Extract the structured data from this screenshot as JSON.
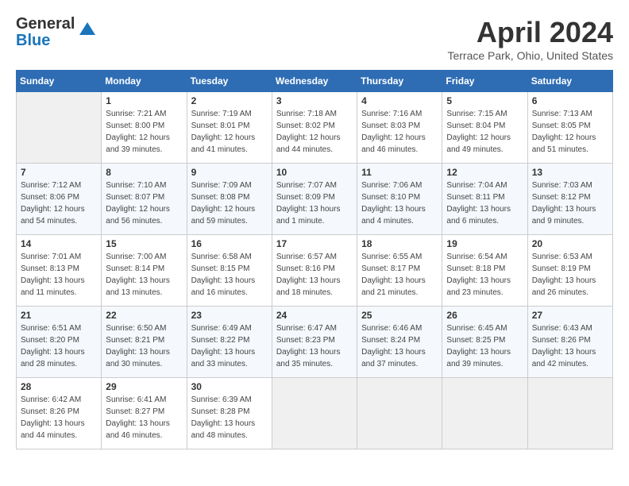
{
  "header": {
    "logo_line1": "General",
    "logo_line2": "Blue",
    "title": "April 2024",
    "subtitle": "Terrace Park, Ohio, United States"
  },
  "columns": [
    "Sunday",
    "Monday",
    "Tuesday",
    "Wednesday",
    "Thursday",
    "Friday",
    "Saturday"
  ],
  "weeks": [
    [
      {
        "num": "",
        "sunrise": "",
        "sunset": "",
        "daylight": "",
        "empty": true
      },
      {
        "num": "1",
        "sunrise": "Sunrise: 7:21 AM",
        "sunset": "Sunset: 8:00 PM",
        "daylight": "Daylight: 12 hours and 39 minutes."
      },
      {
        "num": "2",
        "sunrise": "Sunrise: 7:19 AM",
        "sunset": "Sunset: 8:01 PM",
        "daylight": "Daylight: 12 hours and 41 minutes."
      },
      {
        "num": "3",
        "sunrise": "Sunrise: 7:18 AM",
        "sunset": "Sunset: 8:02 PM",
        "daylight": "Daylight: 12 hours and 44 minutes."
      },
      {
        "num": "4",
        "sunrise": "Sunrise: 7:16 AM",
        "sunset": "Sunset: 8:03 PM",
        "daylight": "Daylight: 12 hours and 46 minutes."
      },
      {
        "num": "5",
        "sunrise": "Sunrise: 7:15 AM",
        "sunset": "Sunset: 8:04 PM",
        "daylight": "Daylight: 12 hours and 49 minutes."
      },
      {
        "num": "6",
        "sunrise": "Sunrise: 7:13 AM",
        "sunset": "Sunset: 8:05 PM",
        "daylight": "Daylight: 12 hours and 51 minutes."
      }
    ],
    [
      {
        "num": "7",
        "sunrise": "Sunrise: 7:12 AM",
        "sunset": "Sunset: 8:06 PM",
        "daylight": "Daylight: 12 hours and 54 minutes."
      },
      {
        "num": "8",
        "sunrise": "Sunrise: 7:10 AM",
        "sunset": "Sunset: 8:07 PM",
        "daylight": "Daylight: 12 hours and 56 minutes."
      },
      {
        "num": "9",
        "sunrise": "Sunrise: 7:09 AM",
        "sunset": "Sunset: 8:08 PM",
        "daylight": "Daylight: 12 hours and 59 minutes."
      },
      {
        "num": "10",
        "sunrise": "Sunrise: 7:07 AM",
        "sunset": "Sunset: 8:09 PM",
        "daylight": "Daylight: 13 hours and 1 minute."
      },
      {
        "num": "11",
        "sunrise": "Sunrise: 7:06 AM",
        "sunset": "Sunset: 8:10 PM",
        "daylight": "Daylight: 13 hours and 4 minutes."
      },
      {
        "num": "12",
        "sunrise": "Sunrise: 7:04 AM",
        "sunset": "Sunset: 8:11 PM",
        "daylight": "Daylight: 13 hours and 6 minutes."
      },
      {
        "num": "13",
        "sunrise": "Sunrise: 7:03 AM",
        "sunset": "Sunset: 8:12 PM",
        "daylight": "Daylight: 13 hours and 9 minutes."
      }
    ],
    [
      {
        "num": "14",
        "sunrise": "Sunrise: 7:01 AM",
        "sunset": "Sunset: 8:13 PM",
        "daylight": "Daylight: 13 hours and 11 minutes."
      },
      {
        "num": "15",
        "sunrise": "Sunrise: 7:00 AM",
        "sunset": "Sunset: 8:14 PM",
        "daylight": "Daylight: 13 hours and 13 minutes."
      },
      {
        "num": "16",
        "sunrise": "Sunrise: 6:58 AM",
        "sunset": "Sunset: 8:15 PM",
        "daylight": "Daylight: 13 hours and 16 minutes."
      },
      {
        "num": "17",
        "sunrise": "Sunrise: 6:57 AM",
        "sunset": "Sunset: 8:16 PM",
        "daylight": "Daylight: 13 hours and 18 minutes."
      },
      {
        "num": "18",
        "sunrise": "Sunrise: 6:55 AM",
        "sunset": "Sunset: 8:17 PM",
        "daylight": "Daylight: 13 hours and 21 minutes."
      },
      {
        "num": "19",
        "sunrise": "Sunrise: 6:54 AM",
        "sunset": "Sunset: 8:18 PM",
        "daylight": "Daylight: 13 hours and 23 minutes."
      },
      {
        "num": "20",
        "sunrise": "Sunrise: 6:53 AM",
        "sunset": "Sunset: 8:19 PM",
        "daylight": "Daylight: 13 hours and 26 minutes."
      }
    ],
    [
      {
        "num": "21",
        "sunrise": "Sunrise: 6:51 AM",
        "sunset": "Sunset: 8:20 PM",
        "daylight": "Daylight: 13 hours and 28 minutes."
      },
      {
        "num": "22",
        "sunrise": "Sunrise: 6:50 AM",
        "sunset": "Sunset: 8:21 PM",
        "daylight": "Daylight: 13 hours and 30 minutes."
      },
      {
        "num": "23",
        "sunrise": "Sunrise: 6:49 AM",
        "sunset": "Sunset: 8:22 PM",
        "daylight": "Daylight: 13 hours and 33 minutes."
      },
      {
        "num": "24",
        "sunrise": "Sunrise: 6:47 AM",
        "sunset": "Sunset: 8:23 PM",
        "daylight": "Daylight: 13 hours and 35 minutes."
      },
      {
        "num": "25",
        "sunrise": "Sunrise: 6:46 AM",
        "sunset": "Sunset: 8:24 PM",
        "daylight": "Daylight: 13 hours and 37 minutes."
      },
      {
        "num": "26",
        "sunrise": "Sunrise: 6:45 AM",
        "sunset": "Sunset: 8:25 PM",
        "daylight": "Daylight: 13 hours and 39 minutes."
      },
      {
        "num": "27",
        "sunrise": "Sunrise: 6:43 AM",
        "sunset": "Sunset: 8:26 PM",
        "daylight": "Daylight: 13 hours and 42 minutes."
      }
    ],
    [
      {
        "num": "28",
        "sunrise": "Sunrise: 6:42 AM",
        "sunset": "Sunset: 8:26 PM",
        "daylight": "Daylight: 13 hours and 44 minutes."
      },
      {
        "num": "29",
        "sunrise": "Sunrise: 6:41 AM",
        "sunset": "Sunset: 8:27 PM",
        "daylight": "Daylight: 13 hours and 46 minutes."
      },
      {
        "num": "30",
        "sunrise": "Sunrise: 6:39 AM",
        "sunset": "Sunset: 8:28 PM",
        "daylight": "Daylight: 13 hours and 48 minutes."
      },
      {
        "num": "",
        "sunrise": "",
        "sunset": "",
        "daylight": "",
        "empty": true
      },
      {
        "num": "",
        "sunrise": "",
        "sunset": "",
        "daylight": "",
        "empty": true
      },
      {
        "num": "",
        "sunrise": "",
        "sunset": "",
        "daylight": "",
        "empty": true
      },
      {
        "num": "",
        "sunrise": "",
        "sunset": "",
        "daylight": "",
        "empty": true
      }
    ]
  ]
}
